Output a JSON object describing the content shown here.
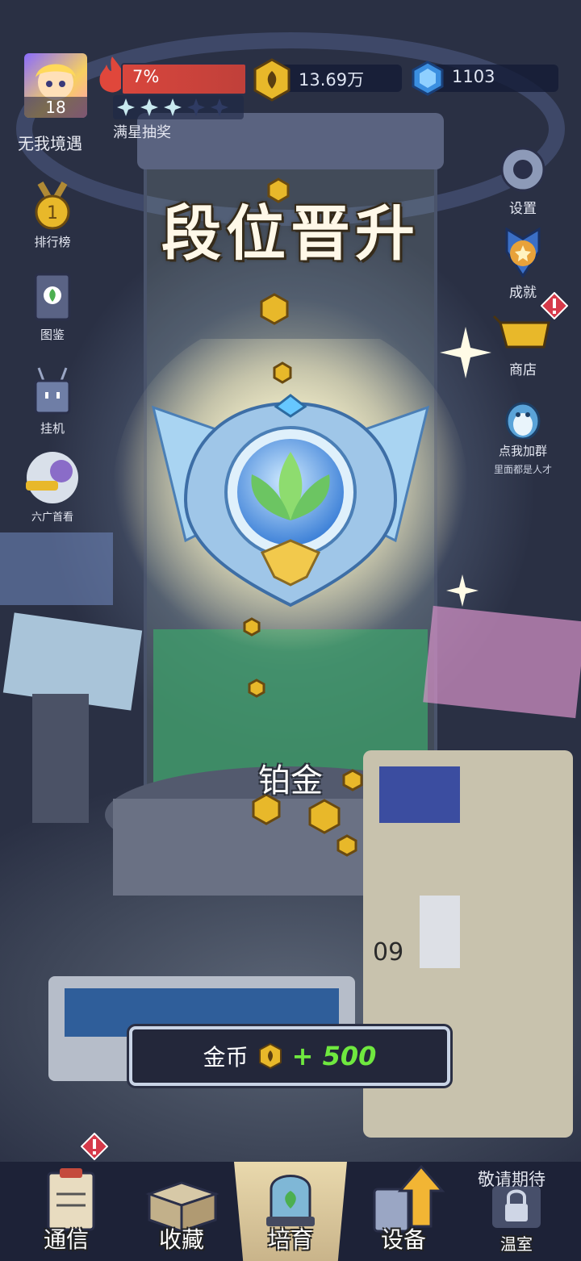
{
  "player": {
    "name": "无我境遇",
    "level": "18"
  },
  "progress": {
    "percent_label": "7%",
    "value": 0.07,
    "star_reward_label": "满星抽奖",
    "stars_filled": 3,
    "stars_total": 5
  },
  "currency": {
    "coins": "13.69万",
    "gems": "1103"
  },
  "left_menu": [
    {
      "id": "leaderboard",
      "label": "排行榜",
      "icon": "medal-icon"
    },
    {
      "id": "collection",
      "label": "图鉴",
      "icon": "book-icon"
    },
    {
      "id": "idle",
      "label": "挂机",
      "icon": "robot-icon"
    },
    {
      "id": "ad",
      "label": "六广首看",
      "icon": "character-avatar-icon"
    }
  ],
  "right_menu": [
    {
      "id": "settings",
      "label": "设置",
      "icon": "gear-icon"
    },
    {
      "id": "achievements",
      "label": "成就",
      "icon": "star-badge-icon"
    },
    {
      "id": "shop",
      "label": "商店",
      "icon": "cart-icon",
      "alert": true
    },
    {
      "id": "group",
      "label": "点我加群",
      "sublabel": "里面都是人才",
      "icon": "penguin-icon"
    }
  ],
  "popup": {
    "title": "段位晋升",
    "rank": "铂金",
    "reward_label": "金币",
    "reward_amount": "+ 500"
  },
  "machine_number": "09",
  "nav": {
    "items": [
      {
        "id": "comms",
        "label": "通信",
        "alert": true
      },
      {
        "id": "collect",
        "label": "收藏"
      },
      {
        "id": "cultivate",
        "label": "培育",
        "active": true
      },
      {
        "id": "equipment",
        "label": "设备"
      },
      {
        "id": "greenhouse",
        "label": "温室",
        "locked": true
      }
    ],
    "coming_soon": "敬请期待"
  },
  "colors": {
    "reward_green": "#6fe83f",
    "fire_red": "#d8463d",
    "coin_gold": "#e8b82a",
    "gem_blue": "#3b8fe0"
  }
}
